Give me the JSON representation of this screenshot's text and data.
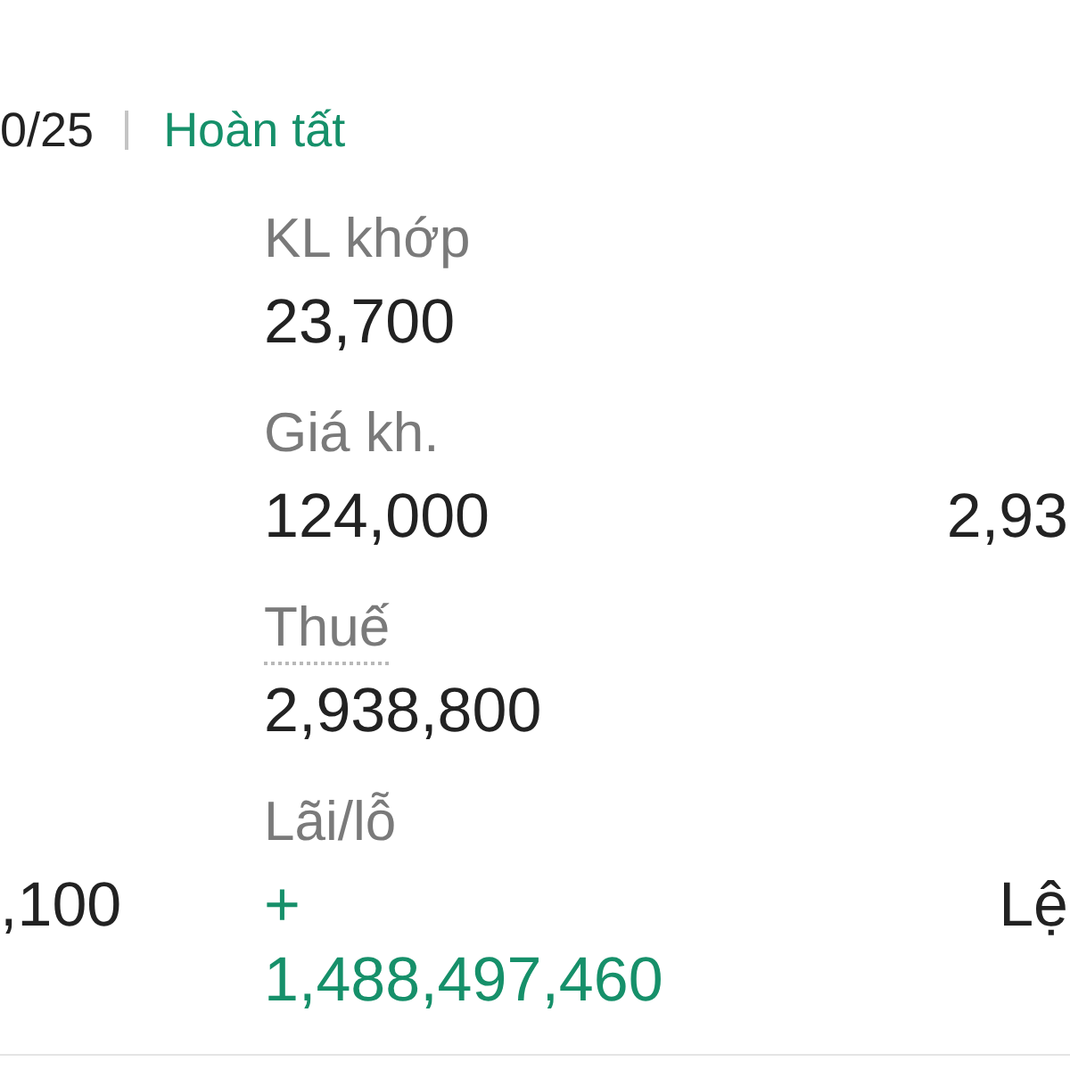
{
  "header": {
    "date": "0/25",
    "status": "Hoàn tất"
  },
  "rows": [
    {
      "column_2": {
        "label": "KL khớp",
        "value": "23,700",
        "has_tooltip": false,
        "gain": false
      }
    },
    {
      "column_2": {
        "label": "Giá kh.",
        "value": "124,000",
        "has_tooltip": false,
        "gain": false
      },
      "column_3": {
        "value": "2,93"
      }
    },
    {
      "column_2": {
        "label": "Thuế",
        "value": "2,938,800",
        "has_tooltip": true,
        "gain": false
      }
    },
    {
      "column_1": {
        "value": ",100"
      },
      "column_2": {
        "label": "Lãi/lỗ",
        "value": "+ 1,488,497,460",
        "has_tooltip": false,
        "gain": true
      },
      "column_3": {
        "value": "Lệ"
      }
    }
  ]
}
